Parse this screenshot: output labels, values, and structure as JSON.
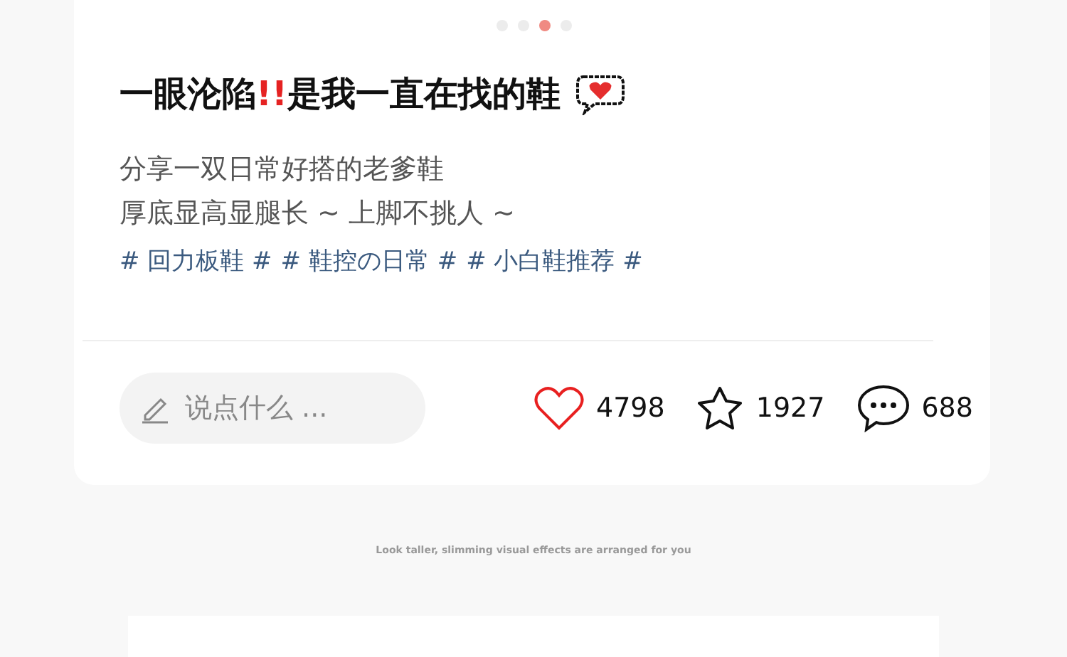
{
  "carousel_dots": [
    {
      "selected": false
    },
    {
      "selected": false
    },
    {
      "selected": true
    },
    {
      "selected": false
    }
  ],
  "title": [
    {
      "text": "一眼沦陷",
      "kind": "plain"
    },
    {
      "text": "!!",
      "kind": "alert"
    },
    {
      "text": "是我一直在找的鞋",
      "kind": "plain"
    }
  ],
  "description": [
    "分享一双日常好搭的老爹鞋",
    "厚底显高显腿长 ~ 上脚不挑人 ~"
  ],
  "tags": [
    "# 回力板鞋 #",
    "# 鞋控の日常 #",
    "# 小白鞋推荐 #"
  ],
  "comment": {
    "placeholder": "说点什么 ..."
  },
  "stats": [
    {
      "kind": "like",
      "count": "4798"
    },
    {
      "kind": "star",
      "count": "1927"
    },
    {
      "kind": "comment",
      "count": "688"
    }
  ],
  "footer_caption": "Look taller, slimming visual effects are arranged for you"
}
